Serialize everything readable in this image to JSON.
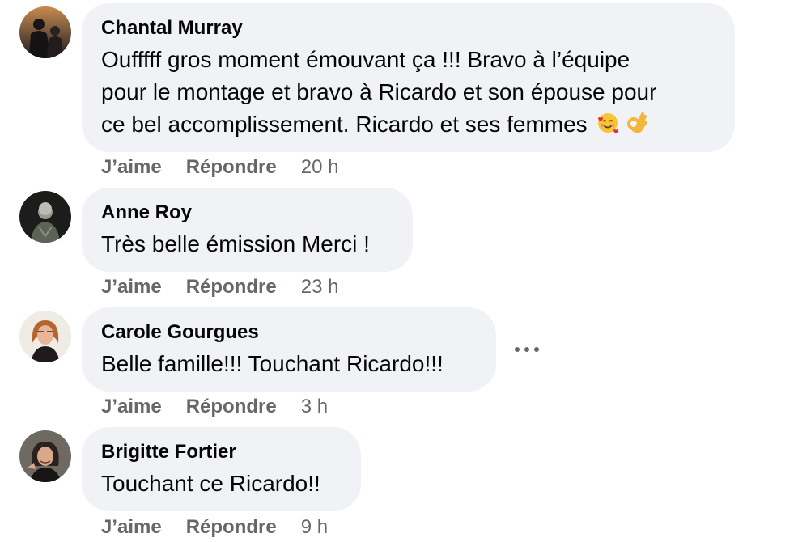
{
  "comments": [
    {
      "author": "Chantal Murray",
      "text_lines": [
        "Oufffff gros moment émouvant ça !!! Bravo à l’équipe",
        "pour le montage et bravo à Ricardo et son épouse pour",
        "ce bel accomplissement. Ricardo et ses femmes"
      ],
      "emojis": [
        "smiling-face-with-hearts",
        "ok-hand"
      ],
      "like_label": "J’aime",
      "reply_label": "Répondre",
      "time": "20 h"
    },
    {
      "author": "Anne Roy",
      "text_lines": [
        "Très belle émission Merci !"
      ],
      "like_label": "J’aime",
      "reply_label": "Répondre",
      "time": "23 h"
    },
    {
      "author": "Carole Gourgues",
      "text_lines": [
        "Belle famille!!! Touchant Ricardo!!!"
      ],
      "like_label": "J’aime",
      "reply_label": "Répondre",
      "time": "3 h",
      "has_more_menu": true
    },
    {
      "author": "Brigitte Fortier",
      "text_lines": [
        "Touchant ce Ricardo!!"
      ],
      "like_label": "J’aime",
      "reply_label": "Répondre",
      "time": "9 h"
    }
  ],
  "colors": {
    "bubble_bg": "#f0f2f5",
    "text": "#050505",
    "secondary": "#65676b"
  }
}
